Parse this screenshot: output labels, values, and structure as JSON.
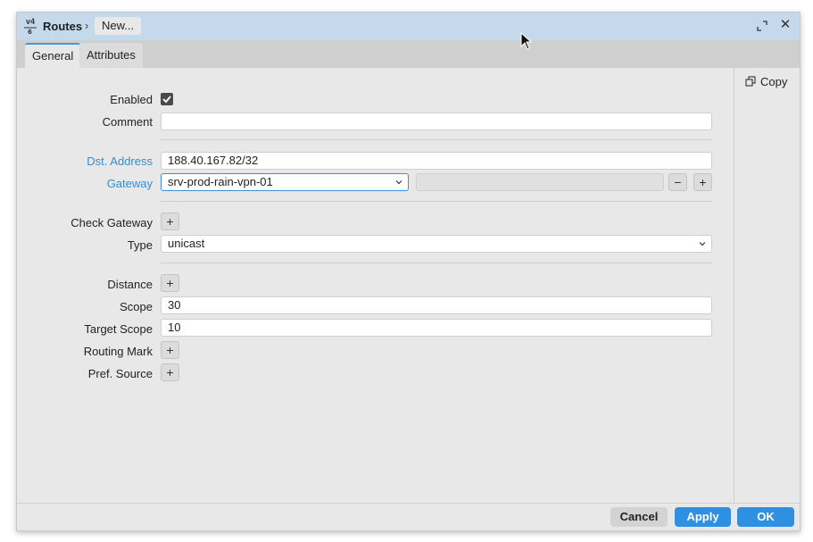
{
  "titlebar": {
    "app_icon": "routes-v4-icon",
    "app_icon_text": "v4",
    "title": "Routes",
    "separator": "›",
    "breadcrumb": "New...",
    "expand_icon": "expand-icon",
    "close_icon": "close-icon",
    "close_glyph": "✕"
  },
  "tabs": [
    {
      "label": "General",
      "active": true
    },
    {
      "label": "Attributes",
      "active": false
    }
  ],
  "side": {
    "copy_label": "Copy",
    "copy_icon": "copy-icon"
  },
  "form": {
    "enabled_label": "Enabled",
    "enabled_checked": true,
    "comment_label": "Comment",
    "comment_value": "",
    "dst_label": "Dst. Address",
    "dst_value": "188.40.167.82/32",
    "gateway_label": "Gateway",
    "gateway_value": "srv-prod-rain-vpn-01",
    "gateway_extra_value": "",
    "minus": "−",
    "plus": "+",
    "check_gateway_label": "Check Gateway",
    "type_label": "Type",
    "type_value": "unicast",
    "distance_label": "Distance",
    "scope_label": "Scope",
    "scope_value": "30",
    "target_scope_label": "Target Scope",
    "target_scope_value": "10",
    "routing_mark_label": "Routing Mark",
    "pref_source_label": "Pref. Source"
  },
  "footer": {
    "cancel": "Cancel",
    "apply": "Apply",
    "ok": "OK"
  },
  "colors": {
    "accent": "#2f8fe0",
    "title_bar": "#c4d9ec",
    "label_blue": "#2f8fd8"
  }
}
